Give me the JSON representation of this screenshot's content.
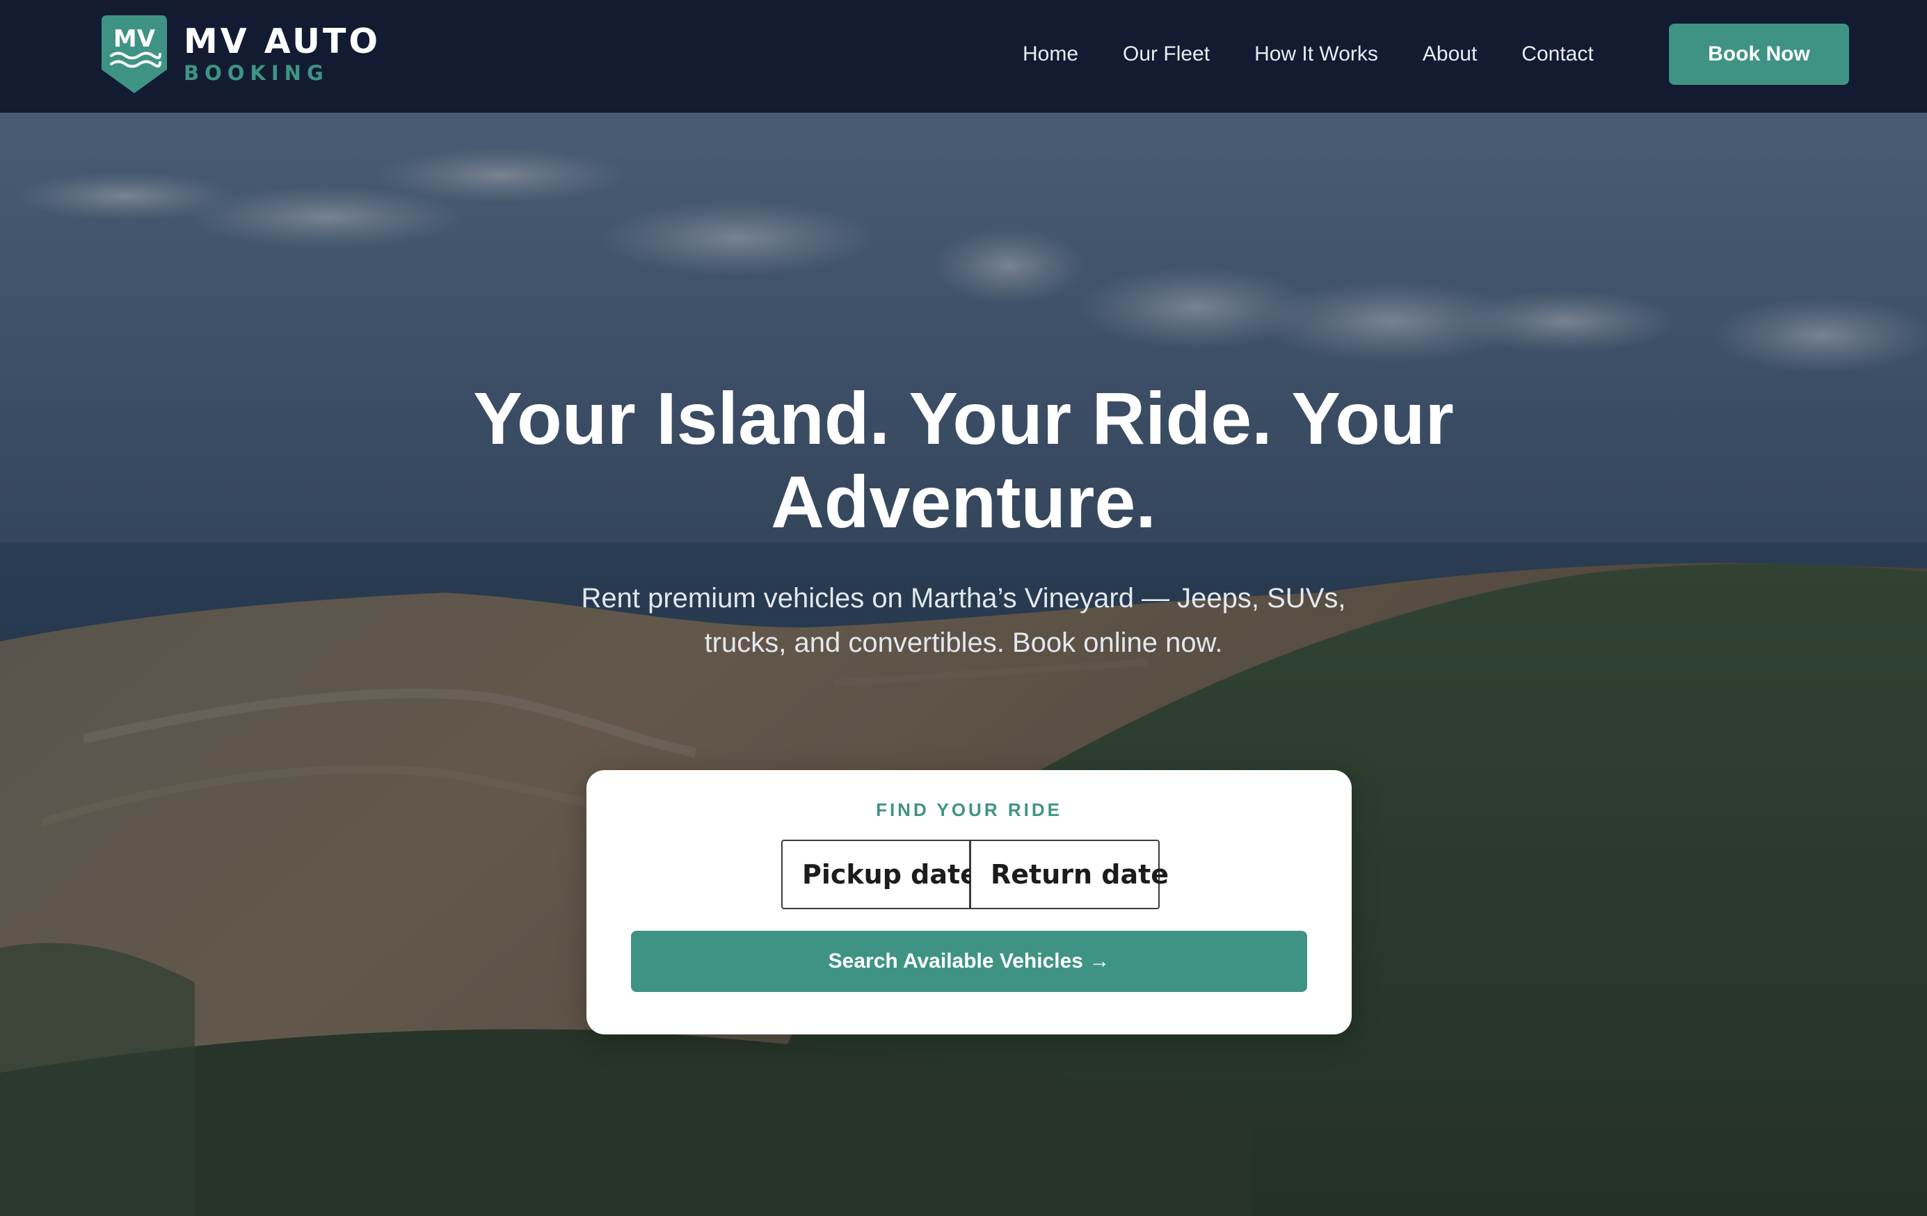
{
  "brand": {
    "badge_text": "MV",
    "name": "MV AUTO",
    "tagline": "BOOKING",
    "accent_color": "#3f9384",
    "nav_bg_color": "#121b31"
  },
  "nav": {
    "links": [
      "Home",
      "Our Fleet",
      "How It Works",
      "About",
      "Contact"
    ],
    "cta_label": "Book Now"
  },
  "hero": {
    "title": "Your Island. Your Ride. Your Adventure.",
    "subtitle": "Rent premium vehicles on Martha’s Vineyard — Jeeps, SUVs, trucks, and convertibles. Book online now."
  },
  "search": {
    "label": "FIND YOUR RIDE",
    "pickup_placeholder": "Pickup date",
    "return_placeholder": "Return date",
    "button_label": "Search Available Vehicles →"
  }
}
